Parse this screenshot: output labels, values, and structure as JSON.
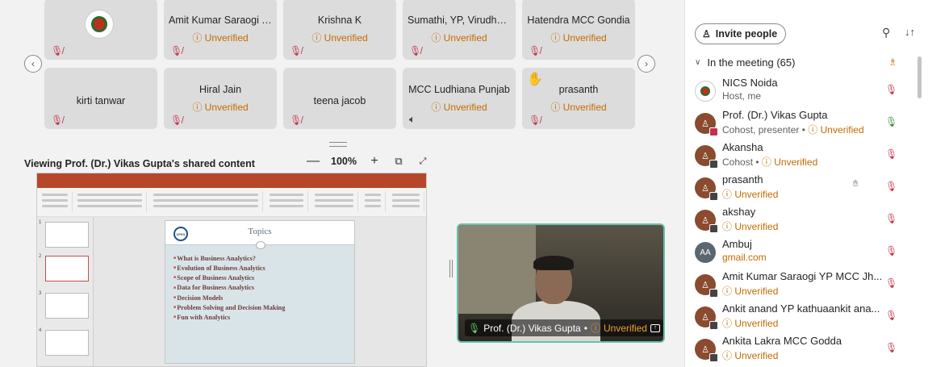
{
  "tiles": [
    {
      "name": "",
      "status": "",
      "logo": true
    },
    {
      "name": "Amit Kumar Saraogi Y...",
      "status": "Unverified"
    },
    {
      "name": "Krishna K",
      "status": "Unverified"
    },
    {
      "name": "Sumathi, YP, Virudhun...",
      "status": "Unverified"
    },
    {
      "name": "Hatendra MCC Gondia",
      "status": "Unverified"
    },
    {
      "name": "kirti tanwar",
      "status": ""
    },
    {
      "name": "Hiral Jain",
      "status": "Unverified"
    },
    {
      "name": "teena jacob",
      "status": ""
    },
    {
      "name": "MCC Ludhiana Punjab",
      "status": "Unverified"
    },
    {
      "name": "prasanth",
      "status": "Unverified",
      "hand": true
    }
  ],
  "share": {
    "title": "Viewing Prof. (Dr.) Vikas Gupta's shared content",
    "zoom": "100%"
  },
  "slide": {
    "title": "Topics",
    "items": [
      "What is Business Analytics?",
      "Evolution of Business Analytics",
      "Scope of Business Analytics",
      "Data for Business Analytics",
      "Decision Models",
      "Problem Solving and Decision Making",
      "Fun with Analytics"
    ]
  },
  "camera": {
    "name": "Prof. (Dr.) Vikas Gupta",
    "status": "Unverified"
  },
  "panel": {
    "invite_label": "Invite people",
    "section_label": "In the meeting (65)",
    "people": [
      {
        "name": "NICS Noida",
        "sub": "Host, me",
        "unv": "",
        "avatar": "logo",
        "mic": "muted"
      },
      {
        "name": "Prof. (Dr.) Vikas Gupta",
        "sub": "Cohost, presenter • ",
        "unv": "Unverified",
        "avatar": "photo",
        "mic": "on"
      },
      {
        "name": "Akansha",
        "sub": "Cohost • ",
        "unv": "Unverified",
        "avatar": "photo",
        "mic": "muted"
      },
      {
        "name": "prasanth",
        "sub": "",
        "unv": "Unverified",
        "avatar": "photo",
        "mic": "muted",
        "hand": true
      },
      {
        "name": "akshay",
        "sub": "",
        "unv": "Unverified",
        "avatar": "photo",
        "mic": "muted"
      },
      {
        "name": "Ambuj",
        "sub": "gmail.com",
        "unv": "",
        "avatar": "AA",
        "mic": "muted",
        "subColor": "#c46b00"
      },
      {
        "name": "Amit Kumar Saraogi YP MCC Jh...",
        "sub": "",
        "unv": "Unverified",
        "avatar": "photo",
        "mic": "muted"
      },
      {
        "name": "Ankit anand YP kathuaankit ana...",
        "sub": "",
        "unv": "Unverified",
        "avatar": "photo",
        "mic": "muted"
      },
      {
        "name": "Ankita Lakra MCC Godda",
        "sub": "",
        "unv": "Unverified",
        "avatar": "photo",
        "mic": "muted"
      }
    ]
  }
}
